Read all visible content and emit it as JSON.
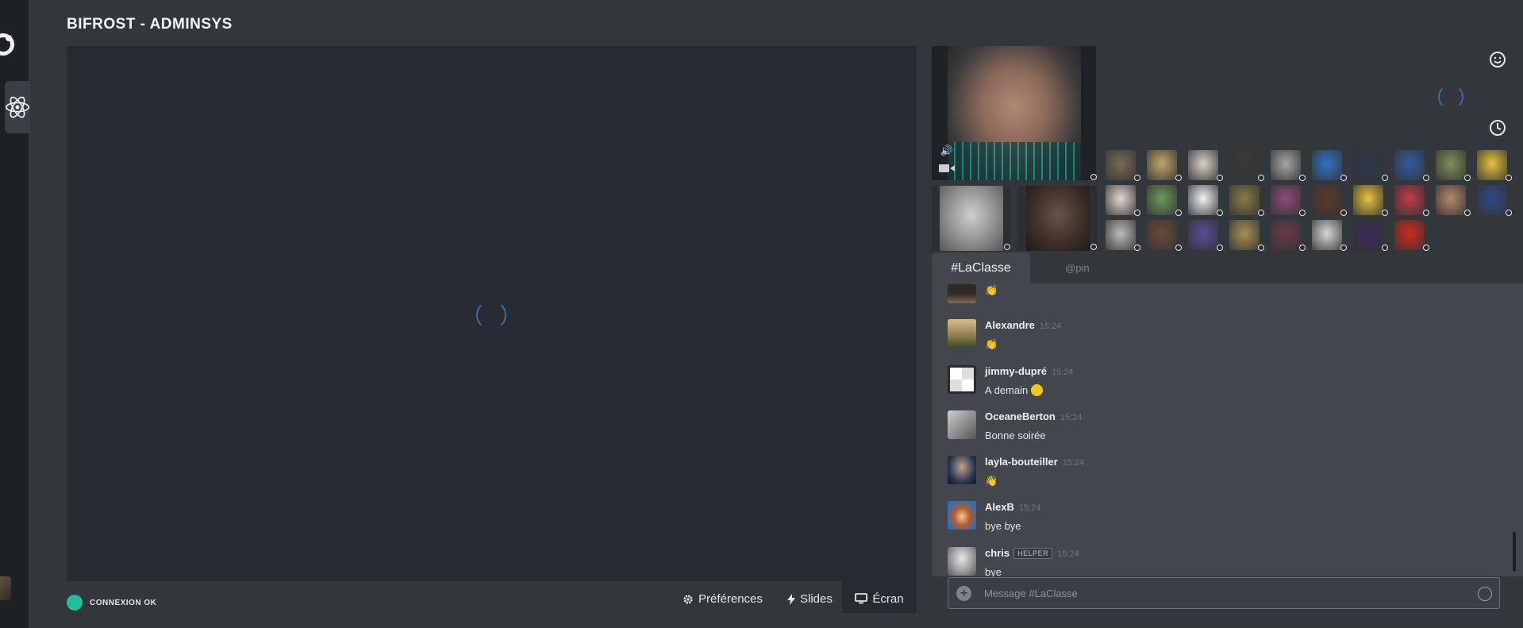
{
  "header": {
    "title": "BIFROST - ADMINSYS"
  },
  "rail": {
    "logo_icon": "owl-logo-icon",
    "active_icon": "react-atom-icon"
  },
  "status": {
    "label": "CONNEXION OK",
    "color": "#1fbf9a"
  },
  "controls": {
    "preferences": "Préférences",
    "slides": "Slides",
    "screen": "Écran"
  },
  "chat": {
    "tabs": [
      "#LaClasse",
      "@pin"
    ],
    "messages": [
      {
        "author": "",
        "time": "",
        "text": "👏",
        "avatar_color": "#3a3531"
      },
      {
        "author": "Alexandre",
        "time": "15:24",
        "text": "👏",
        "avatar_color": "#b89a62"
      },
      {
        "author": "jimmy-dupré",
        "time": "15:24",
        "text": "A demain",
        "avatar_color": "#f0f0f0",
        "emoji": "slightly-smiling-emoji"
      },
      {
        "author": "OceaneBerton",
        "time": "15:24",
        "text": "Bonne soirée",
        "avatar_color": "#8d8d8d"
      },
      {
        "author": "layla-bouteiller",
        "time": "15:24",
        "text": "👋",
        "avatar_color": "#2b3c55"
      },
      {
        "author": "AlexB",
        "time": "15:24",
        "text": "bye bye",
        "avatar_color": "#2d6fb5"
      },
      {
        "author": "chris",
        "badge": "HELPER",
        "time": "15:24",
        "text": "bye",
        "avatar_color": "#9a9a9a"
      }
    ],
    "composer_placeholder": "Message #LaClasse"
  },
  "participants": {
    "row1": [
      "#7a6a55",
      "#c4a46b",
      "#d8d0c6",
      "#3a3a3a",
      "#a5a5a5",
      "#2f72c6",
      "#2b3a4d",
      "#2f5da1",
      "#7d8f5a",
      "#e9c23a"
    ],
    "row2": [
      "#e3d8cf",
      "#6a9a5c",
      "#f2f2f2",
      "#8a7a45",
      "#8d4a7a",
      "#5a3a2a",
      "#e9c23a",
      "#c03a4a",
      "#b4876a",
      "#2d4a8a"
    ],
    "row3": [
      "#bcbcbc",
      "#6a4a3a",
      "#5a4a9a",
      "#a78f52",
      "#6a3a4a",
      "#d8d8d8",
      "#3a2a5a",
      "#d02a1a"
    ],
    "big": [
      "#8e8e8e",
      "#4a3a33"
    ]
  }
}
